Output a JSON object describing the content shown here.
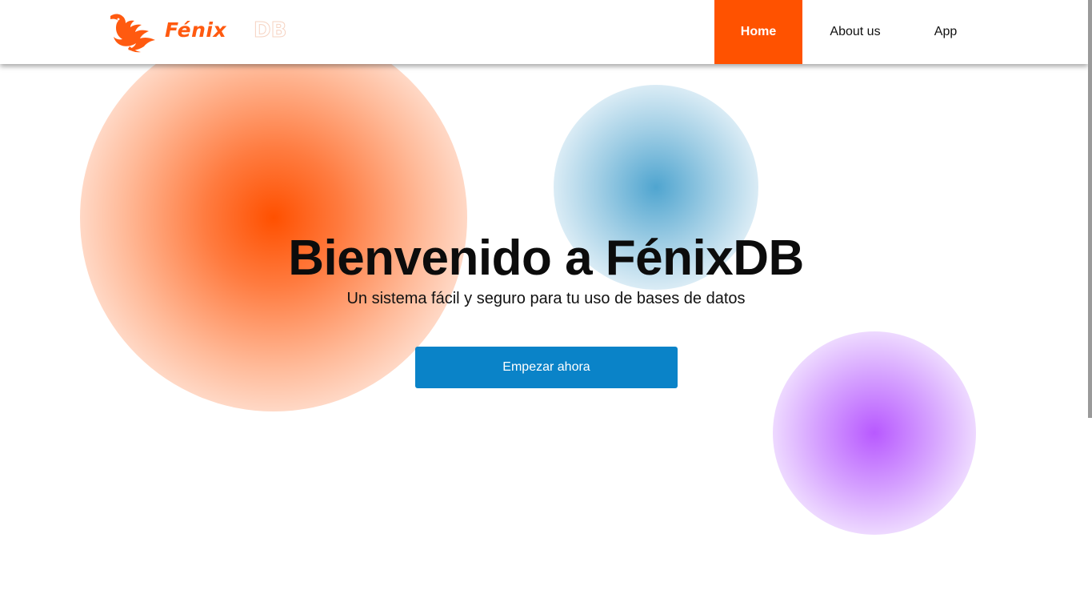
{
  "brand": {
    "name_part": "Fénix",
    "suffix": "DB",
    "logo_icon": "phoenix-icon",
    "color": "#ff5a10"
  },
  "nav": {
    "items": [
      {
        "label": "Home",
        "active": true
      },
      {
        "label": "About us",
        "active": false
      },
      {
        "label": "App",
        "active": false
      }
    ],
    "active_color": "#ff5200"
  },
  "hero": {
    "title": "Bienvenido a FénixDB",
    "subtitle": "Un sistema fácil y seguro para tu uso de bases de datos",
    "cta_label": "Empezar ahora",
    "cta_color": "#0a83c8"
  },
  "decor": {
    "blob_colors": [
      "#ff5000",
      "#46a0cd",
      "#b450ff"
    ]
  }
}
